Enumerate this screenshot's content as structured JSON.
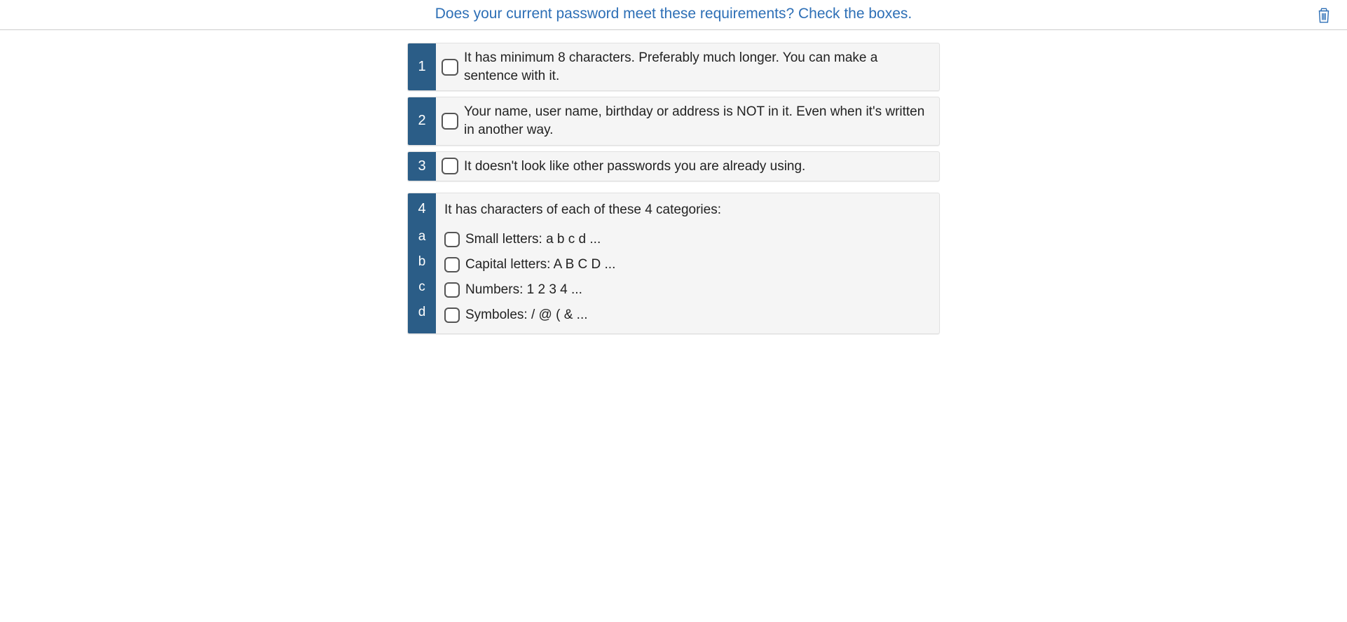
{
  "header": {
    "title": "Does your current password meet these requirements? Check the boxes."
  },
  "items": [
    {
      "num": "1",
      "text": "It has minimum 8 characters. Preferably much longer. You can make a sentence with it."
    },
    {
      "num": "2",
      "text": "Your name, user name, birthday or address is NOT in it. Even when it's written in another way."
    },
    {
      "num": "3",
      "text": "It doesn't look like other passwords you are already using."
    }
  ],
  "group": {
    "num": "4",
    "title": "It has characters of each of these 4 categories:",
    "subs": [
      {
        "letter": "a",
        "text": "Small letters: a b c d ..."
      },
      {
        "letter": "b",
        "text": "Capital letters: A B C D ..."
      },
      {
        "letter": "c",
        "text": "Numbers: 1 2 3 4 ..."
      },
      {
        "letter": "d",
        "text": "Symboles: / @ ( & ..."
      }
    ]
  }
}
